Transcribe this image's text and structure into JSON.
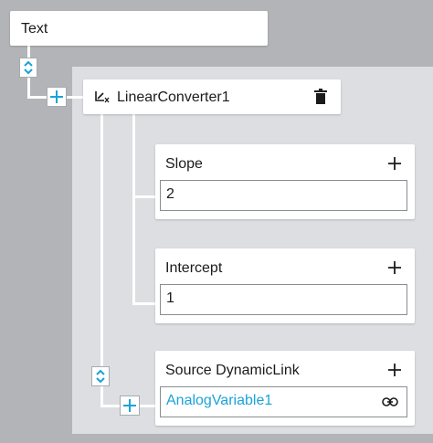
{
  "root": {
    "label": "Text"
  },
  "converter": {
    "label": "LinearConverter1"
  },
  "slope": {
    "label": "Slope",
    "value": "2"
  },
  "intercept": {
    "label": "Intercept",
    "value": "1"
  },
  "source": {
    "label": "Source DynamicLink",
    "value": "AnalogVariable1"
  },
  "icons": {
    "reorder": "chevron-up-down-icon",
    "add": "plus-icon",
    "delete": "trash-icon",
    "converter": "linear-converter-icon",
    "link": "link-icon"
  },
  "colors": {
    "background": "#b2b4b7",
    "panel": "#dcdee1",
    "accent": "#1aa3d6",
    "text": "#1b1b1b"
  }
}
